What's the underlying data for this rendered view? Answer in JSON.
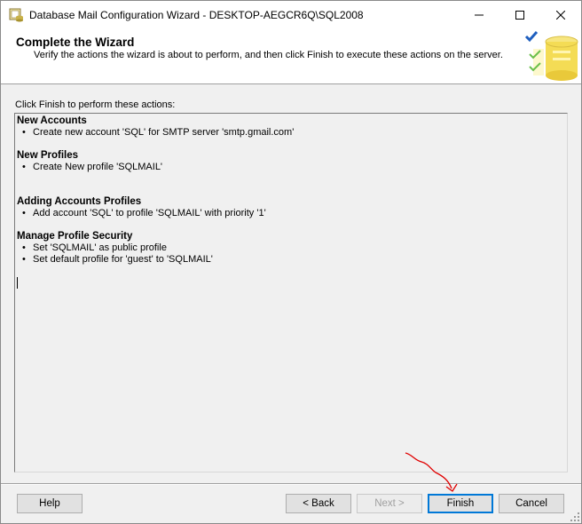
{
  "window": {
    "title": "Database Mail Configuration Wizard - DESKTOP-AEGCR6Q\\SQL2008"
  },
  "header": {
    "title": "Complete the Wizard",
    "subtitle": "Verify the actions the wizard is about to perform, and then click Finish to execute these actions on the server."
  },
  "instruction": "Click Finish to perform these actions:",
  "sections": [
    {
      "title": "New Accounts",
      "items": [
        "Create new account 'SQL' for SMTP server 'smtp.gmail.com'"
      ]
    },
    {
      "title": "New Profiles",
      "items": [
        "Create New profile 'SQLMAIL'"
      ]
    },
    {
      "title": "Adding Accounts Profiles",
      "items": [
        "Add account 'SQL' to profile 'SQLMAIL' with priority '1'"
      ]
    },
    {
      "title": "Manage Profile Security",
      "items": [
        "Set 'SQLMAIL' as public profile",
        "Set default profile for 'guest' to 'SQLMAIL'"
      ]
    }
  ],
  "buttons": {
    "help": "Help",
    "back": "< Back",
    "next": "Next >",
    "finish": "Finish",
    "cancel": "Cancel"
  },
  "icons": {
    "app": "database-mail-icon",
    "minimize": "minimize-icon",
    "maximize": "maximize-icon",
    "close": "close-icon",
    "wizard": "database-checkmark-icon"
  },
  "colors": {
    "focus_border": "#0078d7",
    "annotation": "#e00000"
  }
}
